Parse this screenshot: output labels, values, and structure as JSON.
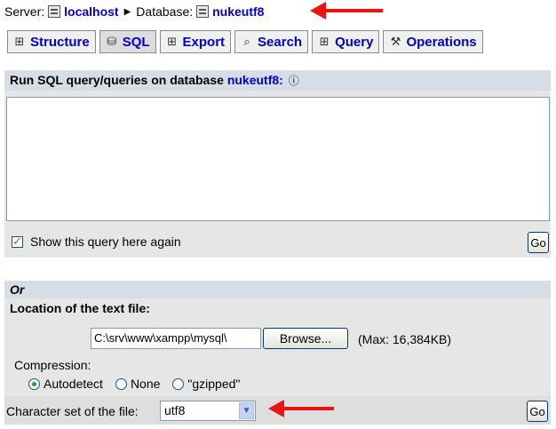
{
  "breadcrumb": {
    "server_label": "Server:",
    "server_name": "localhost",
    "separator": "▶",
    "database_label": "Database:",
    "database_name": "nukeutf8"
  },
  "tabs": [
    {
      "label": "Structure",
      "icon": "structure-icon",
      "glyph": "⊞",
      "active": false
    },
    {
      "label": "SQL",
      "icon": "sql-icon",
      "glyph": "⛁",
      "active": true
    },
    {
      "label": "Export",
      "icon": "export-icon",
      "glyph": "⊞",
      "active": false
    },
    {
      "label": "Search",
      "icon": "search-icon",
      "glyph": "⌕",
      "active": false
    },
    {
      "label": "Query",
      "icon": "query-icon",
      "glyph": "⊞",
      "active": false
    },
    {
      "label": "Operations",
      "icon": "operations-icon",
      "glyph": "⚒",
      "active": false
    }
  ],
  "sql_panel": {
    "title_prefix": "Run SQL query/queries on database",
    "title_db": "nukeutf8:",
    "help_icon": "help-icon",
    "query_value": "",
    "show_again_label": "Show this query here again",
    "show_again_checked": true,
    "go_label": "Go"
  },
  "import_panel": {
    "or_label": "Or",
    "location_label": "Location of the text file:",
    "file_value": "C:\\srv\\www\\xampp\\mysql\\",
    "browse_label": "Browse...",
    "max_label": "(Max: 16,384KB)",
    "compression_label": "Compression:",
    "compression_options": [
      "Autodetect",
      "None",
      "\"gzipped\""
    ],
    "compression_selected": "Autodetect",
    "charset_label": "Character set of the file:",
    "charset_value": "utf8",
    "go_label": "Go"
  },
  "colors": {
    "link": "#0000cc",
    "panel_bg": "#e6e6e6",
    "panel_head_bg": "#d6dde6",
    "annotation_arrow": "#ee1111"
  }
}
